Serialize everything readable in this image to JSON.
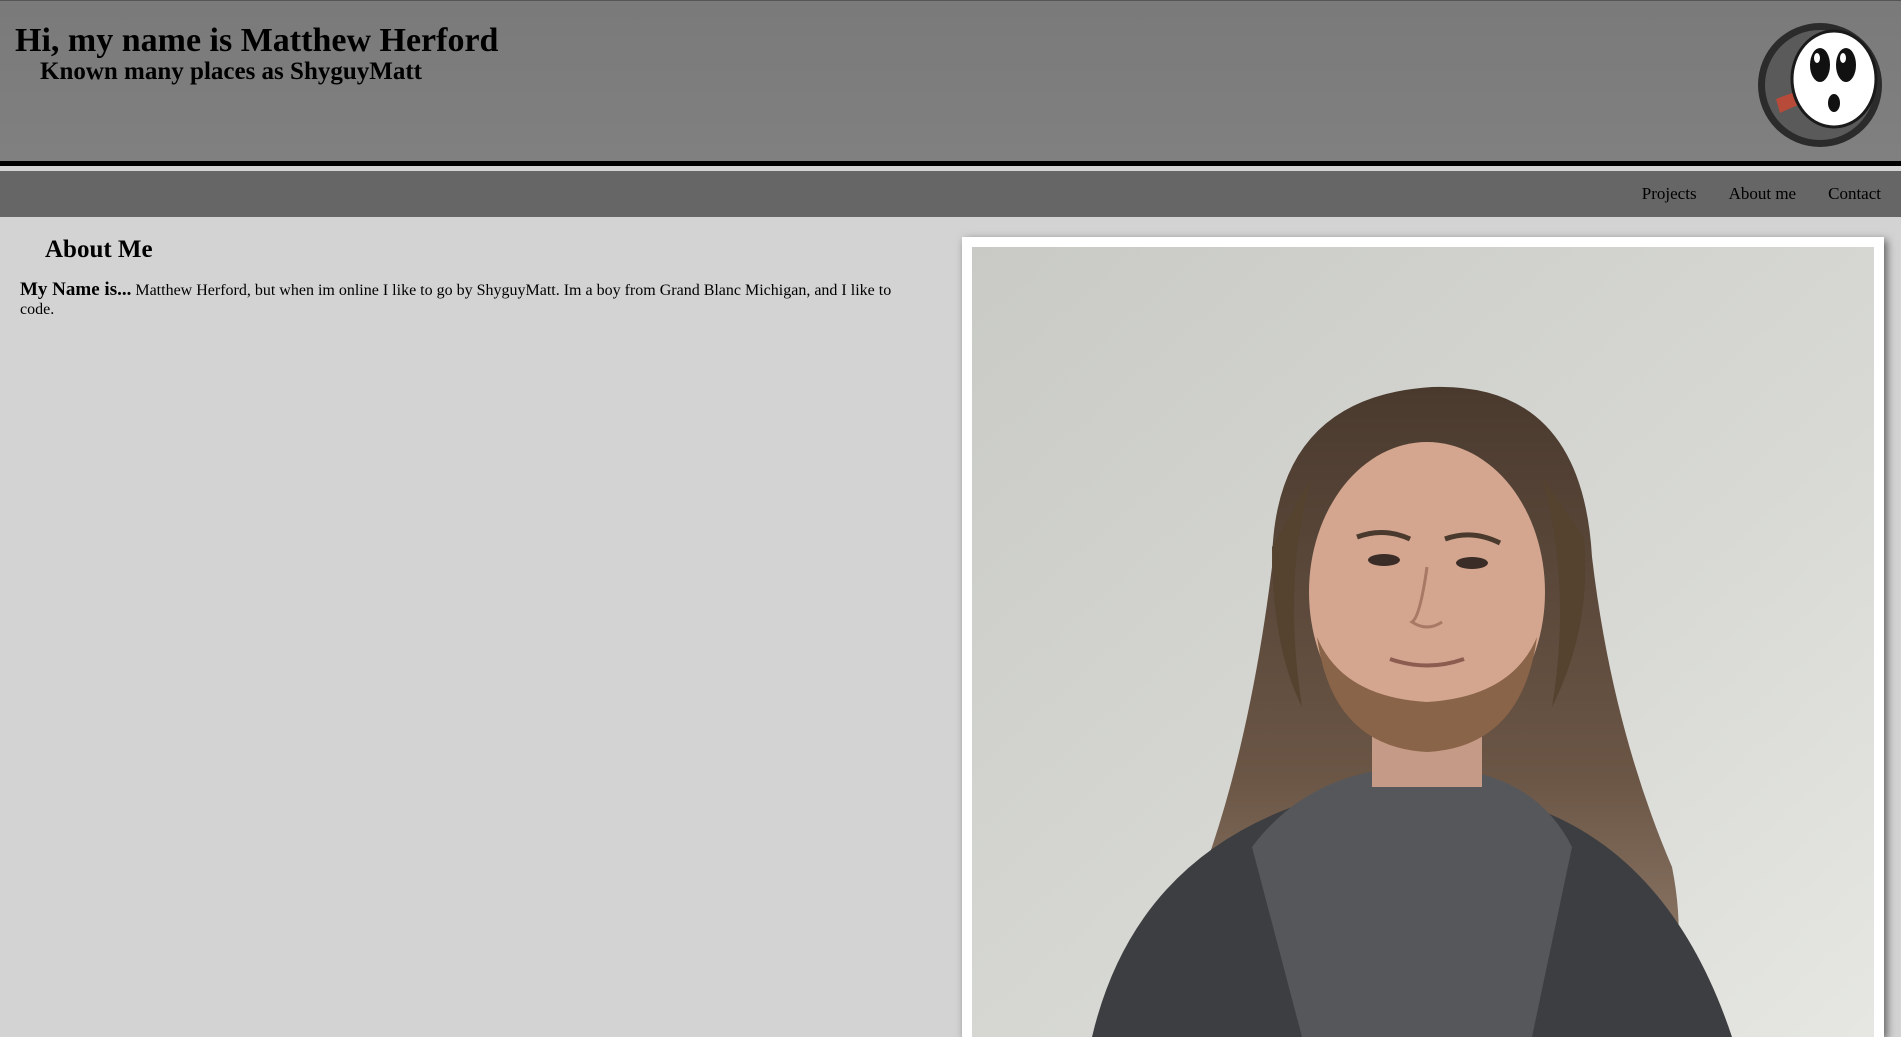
{
  "header": {
    "title": "Hi, my name is Matthew Herford",
    "subtitle": "Known many places as ShyguyMatt",
    "logo_icon": "shyguy-mask-logo-icon"
  },
  "nav": {
    "items": [
      {
        "label": "Projects"
      },
      {
        "label": "About me"
      },
      {
        "label": "Contact"
      }
    ]
  },
  "about": {
    "heading": "About Me",
    "lead": "My Name is...",
    "body": "Matthew Herford, but when im online I like to go by ShyguyMatt. Im a boy from Grand Blanc Michigan, and I like to code."
  },
  "photo": {
    "icon": "portrait-photo"
  },
  "colors": {
    "header_bg": "#808080",
    "nav_bg": "#666666",
    "page_bg": "#d3d3d3",
    "header_border": "#000000"
  }
}
